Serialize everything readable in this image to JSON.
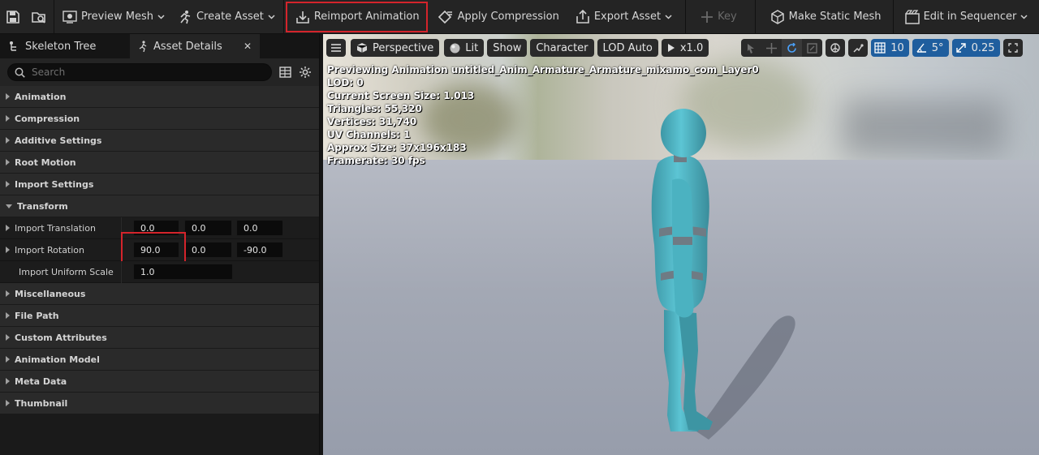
{
  "toolbar": {
    "preview_mesh": "Preview Mesh",
    "create_asset": "Create Asset",
    "reimport_animation": "Reimport Animation",
    "apply_compression": "Apply Compression",
    "export_asset": "Export Asset",
    "key": "Key",
    "make_static_mesh": "Make Static Mesh",
    "edit_in_sequencer": "Edit in Sequencer"
  },
  "tabs": {
    "skeleton_tree": "Skeleton Tree",
    "asset_details": "Asset Details"
  },
  "search": {
    "placeholder": "Search"
  },
  "categories": {
    "animation": "Animation",
    "compression": "Compression",
    "additive_settings": "Additive Settings",
    "root_motion": "Root Motion",
    "import_settings": "Import Settings",
    "transform": "Transform",
    "miscellaneous": "Miscellaneous",
    "file_path": "File Path",
    "custom_attributes": "Custom Attributes",
    "animation_model": "Animation Model",
    "meta_data": "Meta Data",
    "thumbnail": "Thumbnail"
  },
  "transform": {
    "import_translation": {
      "label": "Import Translation",
      "x": "0.0",
      "y": "0.0",
      "z": "0.0"
    },
    "import_rotation": {
      "label": "Import Rotation",
      "x": "90.0",
      "y": "0.0",
      "z": "-90.0"
    },
    "import_uniform_scale": {
      "label": "Import Uniform Scale",
      "value": "1.0"
    }
  },
  "viewport": {
    "perspective": "Perspective",
    "lit": "Lit",
    "show": "Show",
    "character": "Character",
    "lod": "LOD Auto",
    "play_rate": "x1.0",
    "grid_size": "10",
    "rotation_snap": "5°",
    "scale_snap": "0.25"
  },
  "stats": {
    "previewing": "Previewing Animation untitled_Anim_Armature_Armature_mixamo_com_Layer0",
    "lod": "LOD: 0",
    "screen_size": "Current Screen Size: 1.013",
    "triangles": "Triangles: 55,320",
    "vertices": "Vertices: 31,740",
    "uv_channels": "UV Channels: 1",
    "approx_size": "Approx Size: 37x196x183",
    "framerate": "Framerate: 30 fps"
  },
  "colors": {
    "highlight": "#d4242b",
    "mannequin": "#4fb7c7",
    "accent_blue": "#1f5e9e"
  }
}
